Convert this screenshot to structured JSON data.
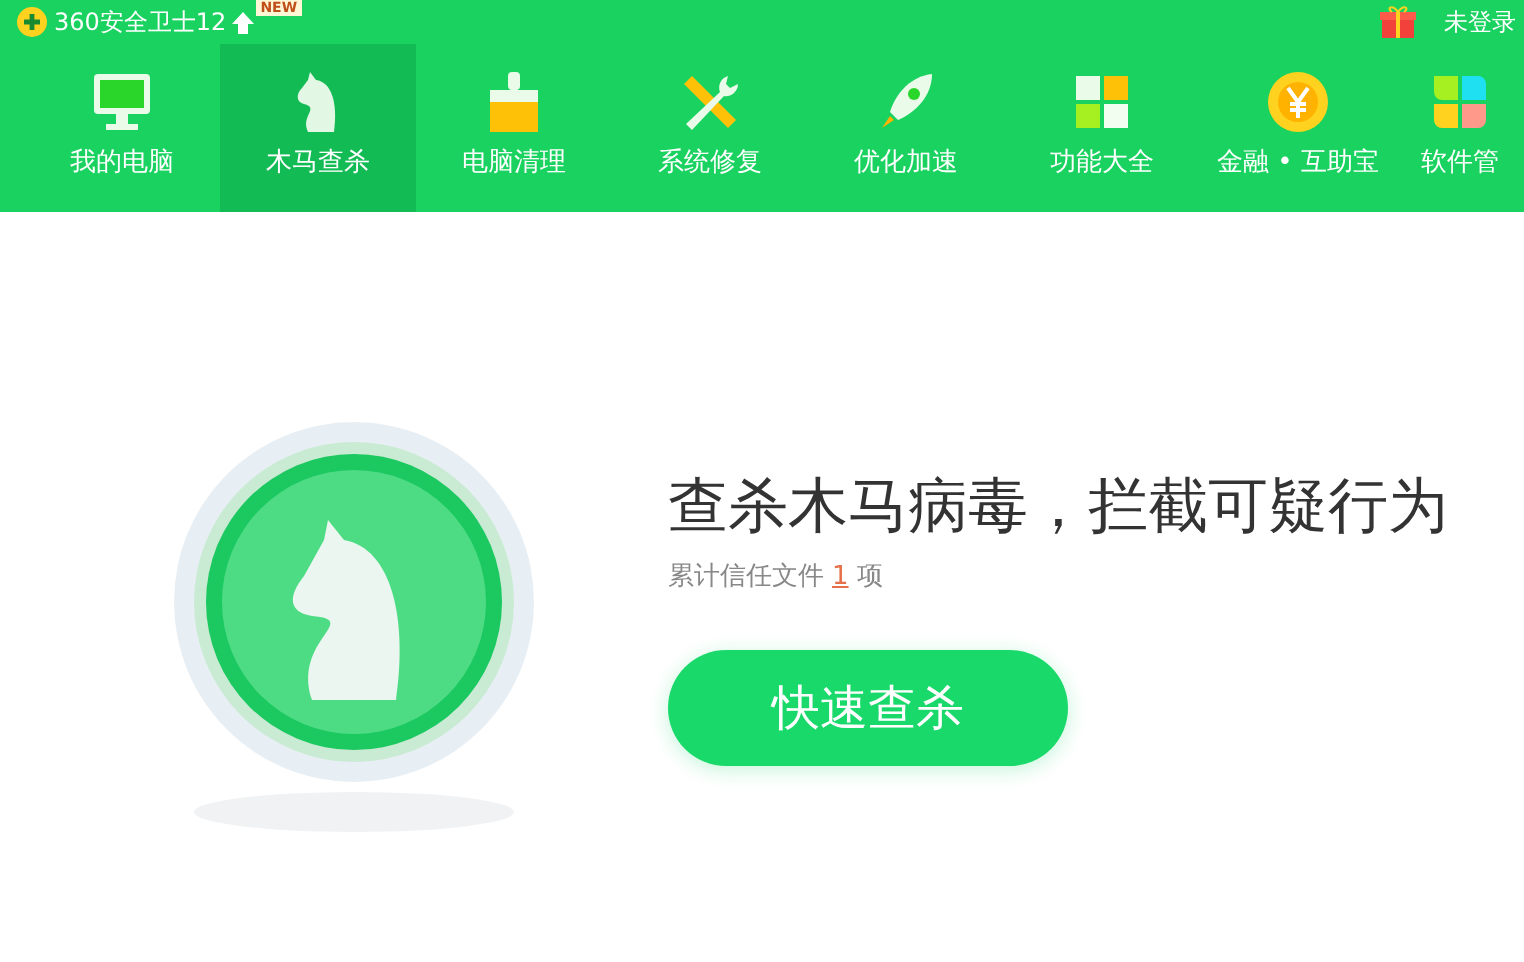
{
  "app": {
    "title": "360安全卫士12",
    "badge": "NEW",
    "login": "未登录"
  },
  "nav": [
    {
      "label": "我的电脑",
      "kind": "monitor",
      "selected": false
    },
    {
      "label": "木马查杀",
      "kind": "horse",
      "selected": true
    },
    {
      "label": "电脑清理",
      "kind": "brush",
      "selected": false
    },
    {
      "label": "系统修复",
      "kind": "tools",
      "selected": false
    },
    {
      "label": "优化加速",
      "kind": "rocket",
      "selected": false
    },
    {
      "label": "功能大全",
      "kind": "grid",
      "selected": false
    },
    {
      "label": "金融 • 互助宝",
      "kind": "coin",
      "selected": false
    },
    {
      "label": "软件管",
      "kind": "apps",
      "selected": false
    }
  ],
  "main": {
    "headline": "查杀木马病毒，拦截可疑行为",
    "trust_prefix": "累计信任文件",
    "trust_count": "1",
    "trust_suffix": "项",
    "scan_button": "快速查杀"
  }
}
